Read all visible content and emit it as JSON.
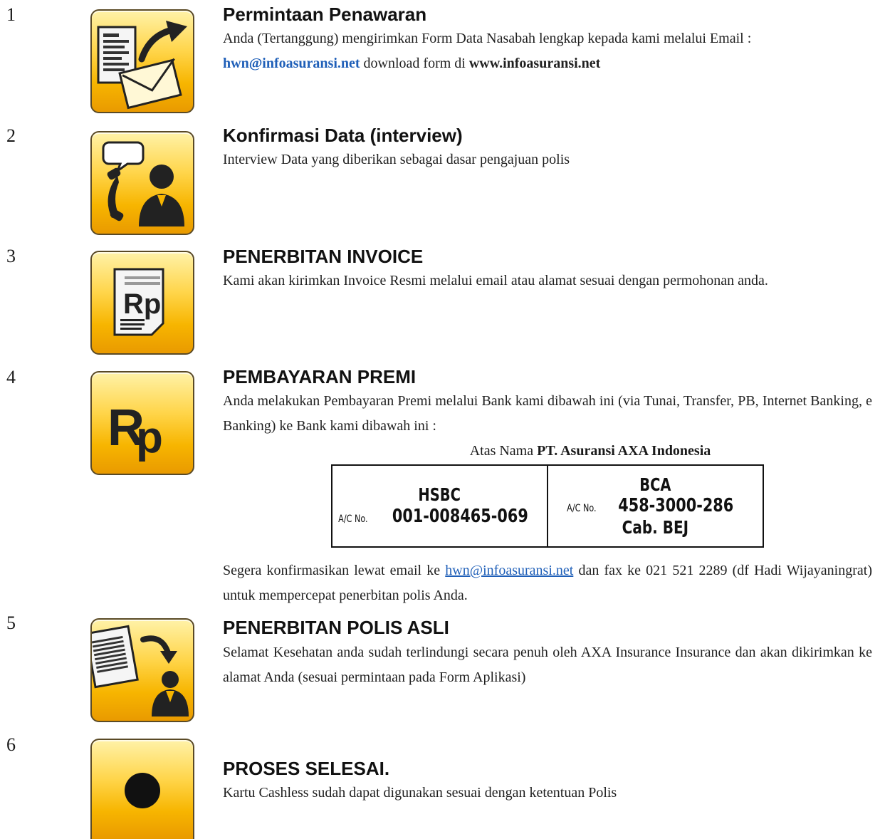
{
  "steps": [
    {
      "number": "1",
      "icon": "document-email-arrow-icon",
      "title": "Permintaan Penawaran",
      "text_before": "Anda (Tertanggung) mengirimkan Form Data Nasabah lengkap kepada kami melalui Email :",
      "email": "hwn@infoasuransi.net",
      "text_middle": " download form di ",
      "website": "www.infoasuransi.net"
    },
    {
      "number": "2",
      "icon": "phone-person-chat-icon",
      "title": "Konfirmasi Data (interview)",
      "text": "Interview Data yang diberikan sebagai dasar pengajuan polis"
    },
    {
      "number": "3",
      "icon": "invoice-rupiah-icon",
      "title": "PENERBITAN INVOICE",
      "text": "Kami akan kirimkan Invoice Resmi melalui email atau alamat sesuai dengan permohonan anda."
    },
    {
      "number": "4",
      "icon": "rupiah-icon",
      "title": "PEMBAYARAN PREMI",
      "text": "Anda melakukan Pembayaran Premi melalui Bank kami dibawah ini (via Tunai, Transfer, PB, Internet Banking, e Banking) ke Bank kami dibawah ini :",
      "account_holder_prefix": "Atas Nama ",
      "account_holder": "PT. Asuransi AXA Indonesia",
      "banks": [
        {
          "name": "HSBC",
          "ac_prefix": "A/C No.",
          "ac_number": "001-008465-069",
          "branch": ""
        },
        {
          "name": "BCA",
          "ac_prefix": "A/C No.",
          "ac_number": "458-3000-286",
          "branch": "Cab. BEJ"
        }
      ],
      "confirm_before": "Segera konfirmasikan lewat email ke ",
      "confirm_email": "hwn@infoasuransi.net",
      "confirm_after": " dan fax ke 021 521 2289 (df Hadi Wijayaningrat) untuk mempercepat penerbitan polis Anda."
    },
    {
      "number": "5",
      "icon": "policy-document-person-icon",
      "title": "PENERBITAN POLIS ASLI",
      "text": "Selamat Kesehatan anda sudah terlindungi secara penuh oleh AXA Insurance Insurance dan akan dikirimkan ke alamat Anda (sesuai permintaan pada Form Aplikasi)"
    },
    {
      "number": "6",
      "icon": "stop-dot-icon",
      "title": "PROSES SELESAI.",
      "text": "Kartu Cashless sudah dapat digunakan sesuai dengan ketentuan Polis"
    }
  ]
}
